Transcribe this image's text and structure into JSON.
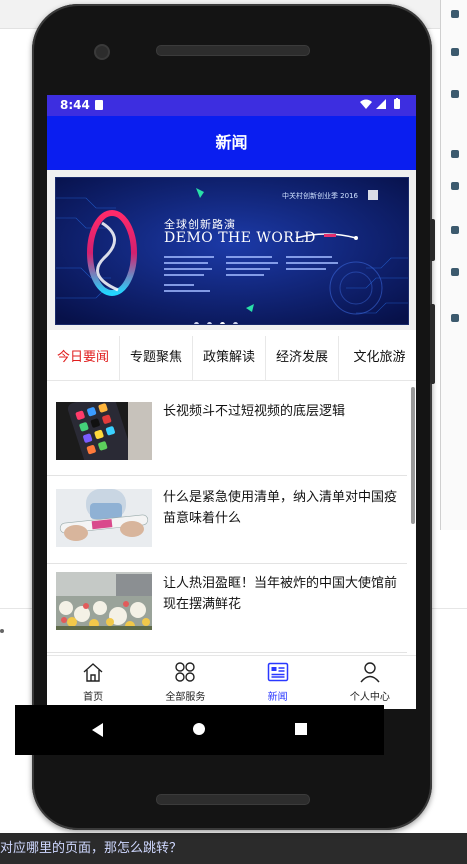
{
  "status_bar": {
    "time": "8:44"
  },
  "app_bar": {
    "title": "新闻"
  },
  "banner": {
    "headline": "全球创新路演",
    "title": "DEMO THE WORLD",
    "event": "中关村创新创业季 2016",
    "dots": 4,
    "active_dot": 2
  },
  "tabs": [
    {
      "label": "今日要闻",
      "active": true
    },
    {
      "label": "专题聚焦",
      "active": false
    },
    {
      "label": "政策解读",
      "active": false
    },
    {
      "label": "经济发展",
      "active": false
    },
    {
      "label": "文化旅游",
      "active": false
    }
  ],
  "news": [
    {
      "title": "长视频斗不过短视频的底层逻辑",
      "thumb": "phone-apps"
    },
    {
      "title": "什么是紧急使用清单，纳入清单对中国疫苗意味着什么",
      "thumb": "vaccine"
    },
    {
      "title": "让人热泪盈眶！当年被炸的中国大使馆前现在摆满鲜花",
      "thumb": "flowers"
    }
  ],
  "bottom_nav": [
    {
      "label": "首页",
      "icon": "home-icon",
      "active": false
    },
    {
      "label": "全部服务",
      "icon": "grid-icon",
      "active": false
    },
    {
      "label": "新闻",
      "icon": "news-icon",
      "active": true
    },
    {
      "label": "个人中心",
      "icon": "person-icon",
      "active": false
    }
  ],
  "desktop": {
    "bottom_text": "对应哪里的页面，那怎么跳转？"
  },
  "colors": {
    "status_bar": "#3d2ee0",
    "app_bar": "#0a1ef0",
    "active_tab": "#e01e1e",
    "active_nav": "#2a38ff"
  }
}
